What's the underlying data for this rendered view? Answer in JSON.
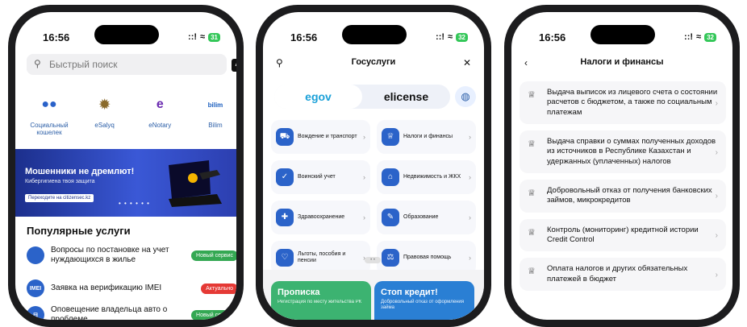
{
  "status": {
    "time": "16:56",
    "signal": "::!",
    "wifi": "≈"
  },
  "phone1": {
    "battery": "31",
    "search_placeholder": "Быстрый поиск",
    "ai_label": "AI",
    "apps": [
      {
        "label": "Социальный кошелек",
        "icon": "social-wallet-icon",
        "glyph": "●●",
        "color": "#2a62c9"
      },
      {
        "label": "eSalyq",
        "icon": "esalyq-icon",
        "glyph": "✹",
        "color": "#8a6a2a"
      },
      {
        "label": "eNotary",
        "icon": "enotary-icon",
        "glyph": "e",
        "color": "#6a2ab0"
      },
      {
        "label": "Bilim",
        "icon": "bilim-icon",
        "glyph": "bilim",
        "color": "#1c5fbf"
      }
    ],
    "banner": {
      "title": "Мошенники не дремлют!",
      "subtitle": "Кибергигиена твоя защита",
      "link": "Переходите на citizensec.kz",
      "dots": "• • • • • •"
    },
    "popular_title": "Популярные услуги",
    "services": [
      {
        "label": "Вопросы по постановке на учет нуждающихся в жилье",
        "badge": "Новый сервис",
        "badge_color": "#34a853",
        "icon_color": "#2b63c9",
        "glyph": ""
      },
      {
        "label": "Заявка на верификацию IMEI",
        "badge": "Актуально",
        "badge_color": "#e53935",
        "icon_color": "#2b63c9",
        "glyph": "IMEI"
      },
      {
        "label": "Оповещение владельца авто о проблеме",
        "badge": "Новый сервис",
        "badge_color": "#34a853",
        "icon_color": "#2b63c9",
        "glyph": "⊟"
      }
    ]
  },
  "phone2": {
    "battery": "32",
    "title": "Госуслуги",
    "search_icon": "⚲",
    "close_icon": "✕",
    "tabs": [
      "egov",
      "elicense"
    ],
    "categories": [
      {
        "label": "Вождение и транспорт",
        "glyph": "⛟"
      },
      {
        "label": "Налоги и финансы",
        "glyph": "♕"
      },
      {
        "label": "Воинский учет",
        "glyph": "✓"
      },
      {
        "label": "Недвижимость и ЖКХ",
        "glyph": "⌂"
      },
      {
        "label": "Здравоохранение",
        "glyph": "✚"
      },
      {
        "label": "Образование",
        "glyph": "✎"
      },
      {
        "label": "Льготы, пособия и пенсии",
        "glyph": "♡"
      },
      {
        "label": "Правовая помощь",
        "glyph": "⚖"
      }
    ],
    "pager": "• •",
    "promos": [
      {
        "title": "Прописка",
        "subtitle": "Регистрация по месту жительства РК",
        "color": "#3cb371"
      },
      {
        "title": "Стоп кредит!",
        "subtitle": "Добровольный отказ от оформления займа",
        "color": "#2a7fd4"
      }
    ]
  },
  "phone3": {
    "battery": "32",
    "title": "Налоги и финансы",
    "back_icon": "‹",
    "items": [
      "Выдача выписок из лицевого счета о состоянии расчетов с бюджетом, а также по социальным платежам",
      "Выдача справки о суммах полученных доходов из источников в Республике Казахстан и удержанных (уплаченных) налогов",
      "Добровольный отказ от получения банковских займов, микрокредитов",
      "Контроль (мониторинг) кредитной истории Credit Control",
      "Оплата налогов и других обязательных платежей в бюджет"
    ]
  }
}
